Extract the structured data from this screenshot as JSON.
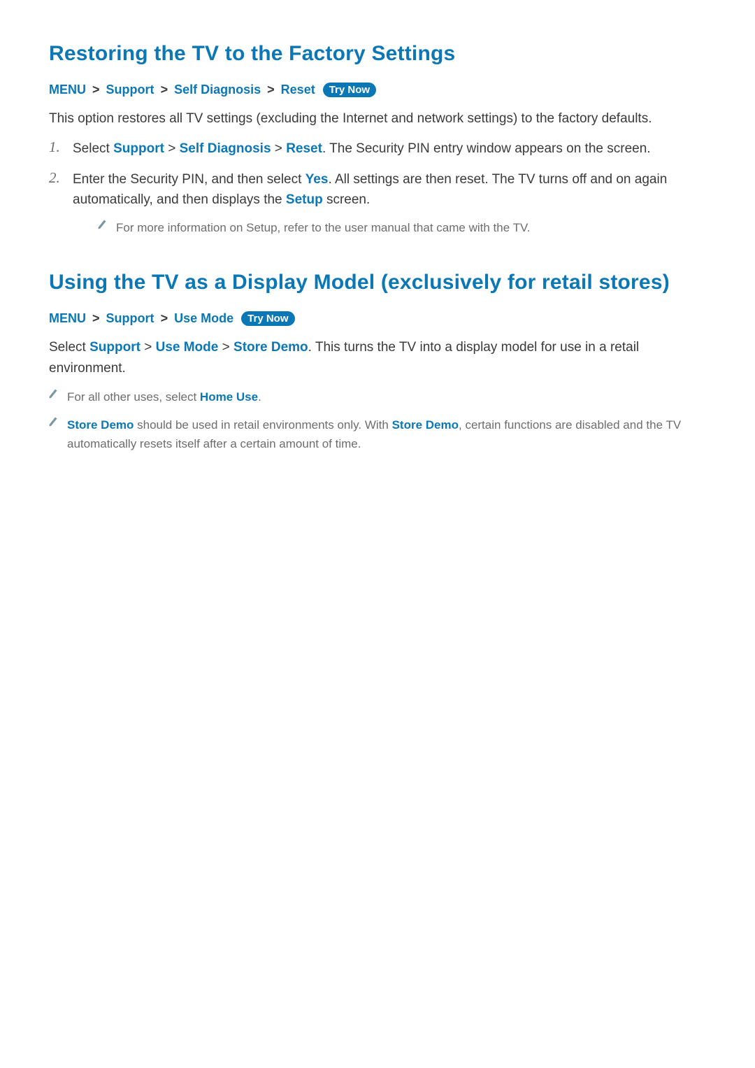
{
  "section1": {
    "title": "Restoring the TV to the Factory Settings",
    "breadcrumb": {
      "root": "MENU",
      "parts": [
        "Support",
        "Self Diagnosis",
        "Reset"
      ],
      "try_now": "Try Now"
    },
    "desc": "This option restores all TV settings (excluding the Internet and network settings) to the factory defaults.",
    "steps": {
      "s1": {
        "num": "1.",
        "pre": "Select ",
        "parts": [
          "Support",
          "Self Diagnosis",
          "Reset"
        ],
        "post": ". The Security PIN entry window appears on the screen."
      },
      "s2": {
        "num": "2.",
        "t1": "Enter the Security PIN, and then select ",
        "yes": "Yes",
        "t2": ". All settings are then reset. The TV turns off and on again automatically, and then displays the ",
        "setup": "Setup",
        "t3": " screen."
      }
    },
    "note": "For more information on Setup, refer to the user manual that came with the TV."
  },
  "section2": {
    "title": "Using the TV as a Display Model (exclusively for retail stores)",
    "breadcrumb": {
      "root": "MENU",
      "parts": [
        "Support",
        "Use Mode"
      ],
      "try_now": "Try Now"
    },
    "para": {
      "t1": "Select ",
      "parts": [
        "Support",
        "Use Mode",
        "Store Demo"
      ],
      "t2": ". This turns the TV into a display model for use in a retail environment."
    },
    "note1": {
      "t1": "For all other uses, select ",
      "home_use": "Home Use",
      "t2": "."
    },
    "note2": {
      "sd1": "Store Demo",
      "t1": " should be used in retail environments only. With ",
      "sd2": "Store Demo",
      "t2": ", certain functions are disabled and the TV automatically resets itself after a certain amount of time."
    }
  },
  "sep": ">"
}
